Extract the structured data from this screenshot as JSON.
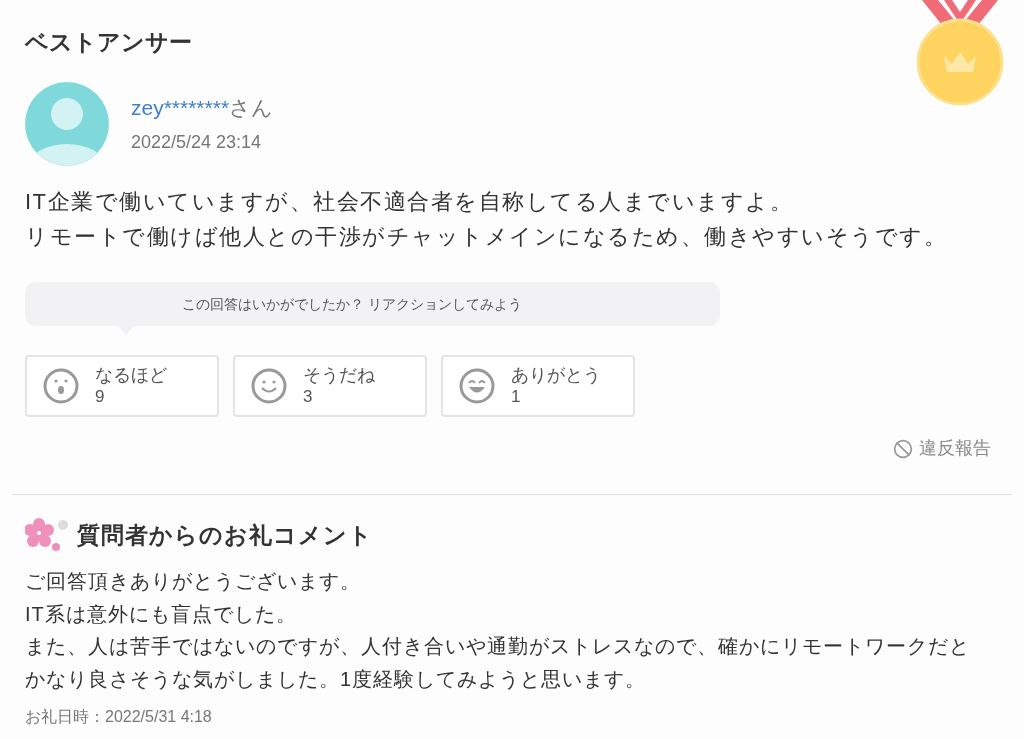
{
  "heading": "ベストアンサー",
  "answer": {
    "user": "zey********",
    "honorific": "さん",
    "date": "2022/5/24 23:14",
    "lines": [
      "IT企業で働いていますが、社会不適合者を自称してる人までいますよ。",
      "リモートで働けば他人との干渉がチャットメインになるため、働きやすいそうです。"
    ]
  },
  "prompt": "この回答はいかがでしたか？ リアクションしてみよう",
  "reactions": [
    {
      "kind": "surprised",
      "label": "なるほど",
      "count": "9"
    },
    {
      "kind": "smile",
      "label": "そうだね",
      "count": "3"
    },
    {
      "kind": "grin",
      "label": "ありがとう",
      "count": "1"
    }
  ],
  "report": "違反報告",
  "thanks": {
    "title": "質問者からのお礼コメント",
    "lines": [
      "ご回答頂きありがとうございます。",
      "IT系は意外にも盲点でした。",
      "また、人は苦手ではないのですが、人付き合いや通勤がストレスなので、確かにリモートワークだとかなり良さそうな気がしました。1度経験してみようと思います。"
    ],
    "date": "お礼日時：2022/5/31 4:18"
  }
}
